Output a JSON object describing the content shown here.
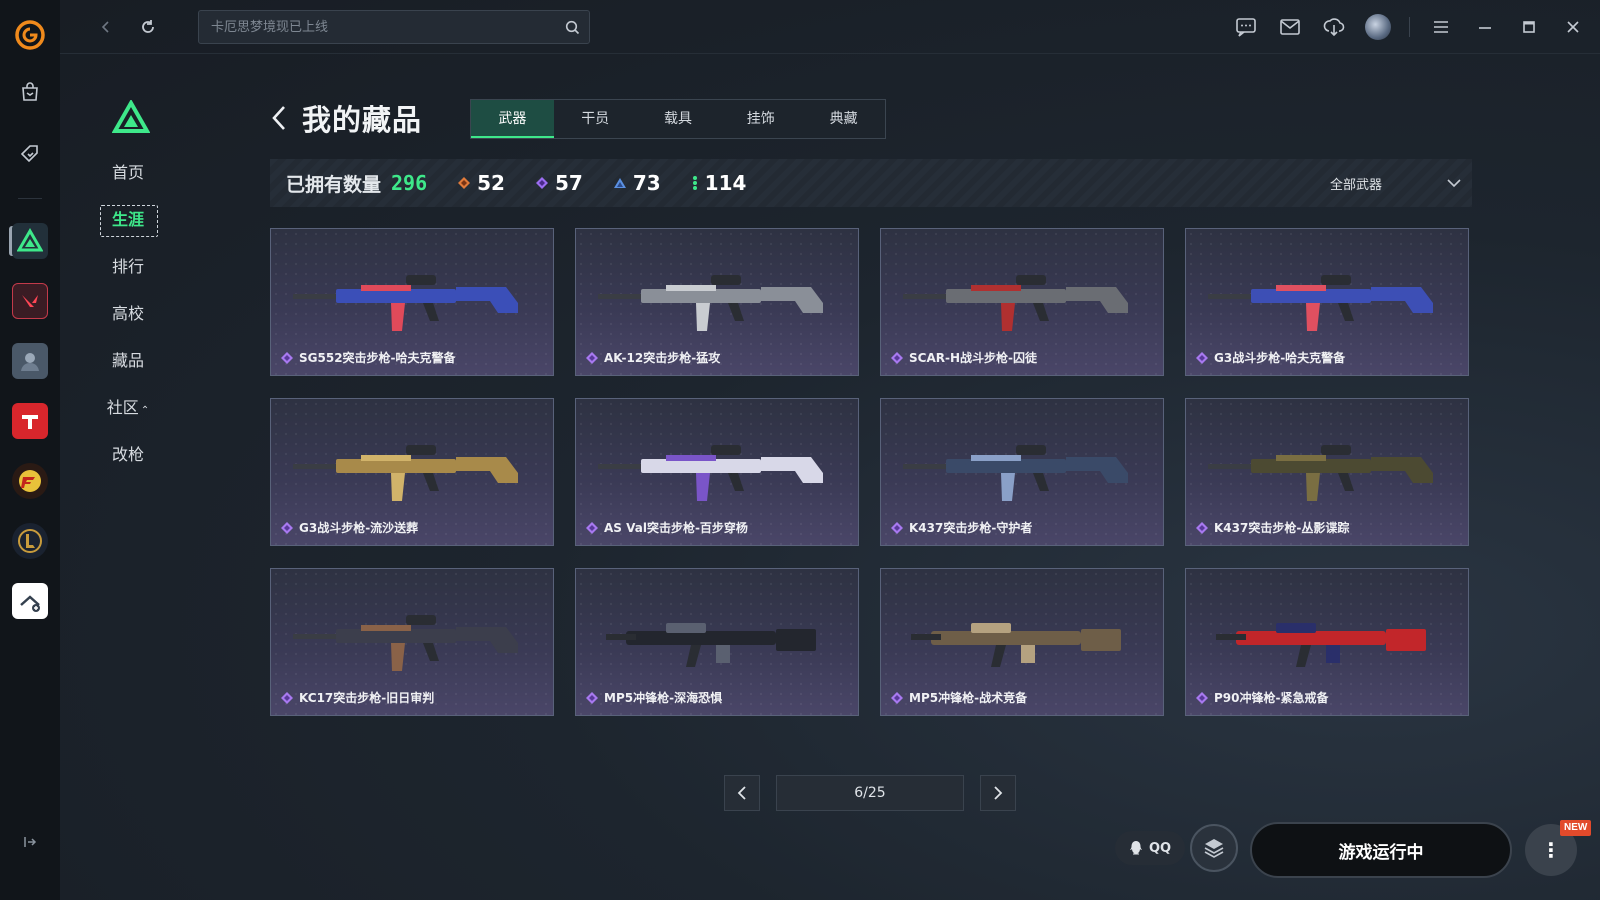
{
  "search": {
    "placeholder": "卡厄思梦境现已上线"
  },
  "subnav": {
    "items": [
      {
        "label": "首页",
        "active": false
      },
      {
        "label": "生涯",
        "active": true
      },
      {
        "label": "排行",
        "active": false
      },
      {
        "label": "高校",
        "active": false
      },
      {
        "label": "藏品",
        "active": false
      },
      {
        "label": "社区",
        "active": false,
        "caret": "⌃"
      },
      {
        "label": "改枪",
        "active": false
      }
    ]
  },
  "header": {
    "title": "我的藏品",
    "tabs": [
      "武器",
      "干员",
      "载具",
      "挂饰",
      "典藏"
    ],
    "active_tab": 0
  },
  "stats": {
    "owned_label": "已拥有数量",
    "owned_total": "296",
    "tiers": [
      {
        "value": "52",
        "color": "#e07a3a"
      },
      {
        "value": "57",
        "color": "#9b6df0"
      },
      {
        "value": "73",
        "color": "#5a8fe0"
      },
      {
        "value": "114",
        "color": "#3ee88a"
      }
    ],
    "filter_label": "全部武器"
  },
  "colors": {
    "accent": "#3ee88a",
    "rare_diamond": "#a879f0"
  },
  "items": [
    {
      "name": "SG552突击步枪-哈夫克警备",
      "skin": "#3b4fb8",
      "accent": "#e04a5a"
    },
    {
      "name": "AK-12突击步枪-猛攻",
      "skin": "#8a8f98",
      "accent": "#c9ccd1"
    },
    {
      "name": "SCAR-H战斗步枪-囚徒",
      "skin": "#6a6d73",
      "accent": "#b03030"
    },
    {
      "name": "G3战斗步枪-哈夫克警备",
      "skin": "#3d4fb5",
      "accent": "#e05060"
    },
    {
      "name": "G3战斗步枪-流沙送葬",
      "skin": "#a88a4a",
      "accent": "#d1b36a"
    },
    {
      "name": "AS Val突击步枪-百步穿杨",
      "skin": "#d8d8e8",
      "accent": "#7a55c8"
    },
    {
      "name": "K437突击步枪-守护者",
      "skin": "#3a4a68",
      "accent": "#8aa0c8"
    },
    {
      "name": "K437突击步枪-丛影谍踪",
      "skin": "#4c4a32",
      "accent": "#7a6e42"
    },
    {
      "name": "KC17突击步枪-旧日审判",
      "skin": "#3c3e4c",
      "accent": "#8a6248"
    },
    {
      "name": "MP5冲锋枪-深海恐惧",
      "skin": "#23262e",
      "accent": "#5a6070"
    },
    {
      "name": "MP5冲锋枪-战术竞备",
      "skin": "#6e5e48",
      "accent": "#b5a280"
    },
    {
      "name": "P90冲锋枪-紧急戒备",
      "skin": "#c2262a",
      "accent": "#2a2f6a"
    }
  ],
  "pager": {
    "label": "6/25"
  },
  "bottom": {
    "qq_label": "QQ",
    "run_label": "游戏运行中",
    "more_label": "⋮",
    "new_badge": "NEW"
  }
}
